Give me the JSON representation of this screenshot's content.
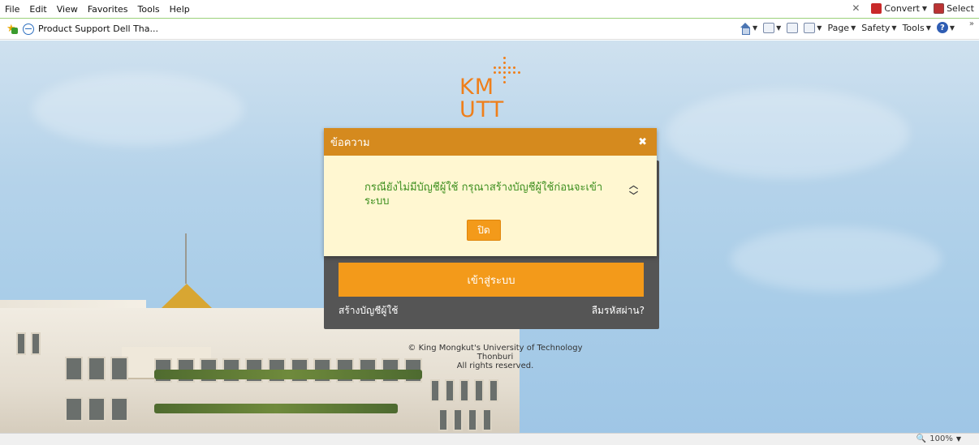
{
  "menu": {
    "items": [
      "File",
      "Edit",
      "View",
      "Favorites",
      "Tools",
      "Help"
    ],
    "convert_label": "Convert",
    "select_label": "Select"
  },
  "favorites": {
    "item_label": "Product Support Dell Tha..."
  },
  "commandbar": {
    "page_label": "Page",
    "safety_label": "Safety",
    "tools_label": "Tools"
  },
  "login": {
    "login_button": "เข้าสู่ระบบ",
    "create_account": "สร้างบัญชีผู้ใช้",
    "forgot_password": "ลืมรหัสผ่าน?"
  },
  "modal": {
    "title": "ข้อความ",
    "close_glyph": "✖",
    "message": "กรณียังไม่มีบัญชีผู้ใช้ กรุณาสร้างบัญชีผู้ใช้ก่อนจะเข้าระบบ",
    "button_label": "ปิด"
  },
  "logo": {
    "line1": "KM",
    "line2": "UTT"
  },
  "footer": {
    "copyright_line1": "© King Mongkut's University of Technology Thonburi",
    "copyright_line2": "All rights reserved."
  },
  "statusbar": {
    "zoom": "100%"
  },
  "colors": {
    "accent_orange": "#f39a1a",
    "modal_header": "#d58a1e",
    "modal_body": "#fff7d1",
    "message_green": "#3b8e1d"
  }
}
